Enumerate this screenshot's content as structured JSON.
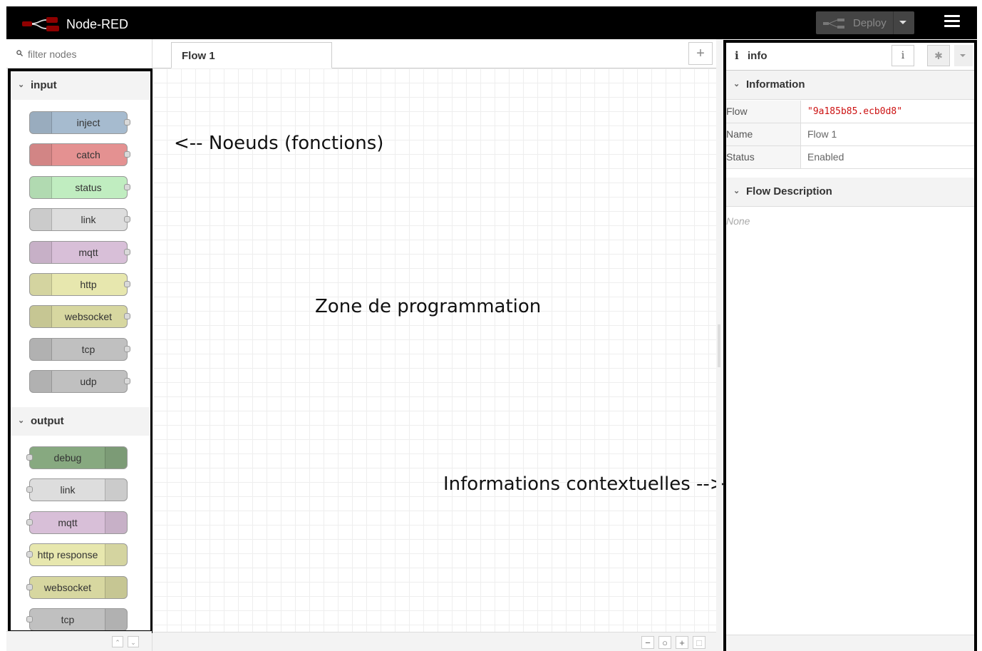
{
  "header": {
    "title": "Node-RED",
    "deploy_label": "Deploy"
  },
  "palette": {
    "filter_placeholder": "filter nodes",
    "categories": [
      {
        "label": "input",
        "nodes": [
          {
            "label": "inject",
            "color": "#a6bbcf"
          },
          {
            "label": "catch",
            "color": "#e49191"
          },
          {
            "label": "status",
            "color": "#c0edc0"
          },
          {
            "label": "link",
            "color": "#dddddd"
          },
          {
            "label": "mqtt",
            "color": "#d8bfd8"
          },
          {
            "label": "http",
            "color": "#e7e7ae"
          },
          {
            "label": "websocket",
            "color": "#d7d7a0"
          },
          {
            "label": "tcp",
            "color": "#c0c0c0"
          },
          {
            "label": "udp",
            "color": "#c0c0c0"
          }
        ]
      },
      {
        "label": "output",
        "nodes": [
          {
            "label": "debug",
            "color": "#87a980"
          },
          {
            "label": "link",
            "color": "#dddddd"
          },
          {
            "label": "mqtt",
            "color": "#d8bfd8"
          },
          {
            "label": "http response",
            "color": "#e7e7ae"
          },
          {
            "label": "websocket",
            "color": "#d7d7a0"
          },
          {
            "label": "tcp",
            "color": "#c0c0c0"
          }
        ]
      }
    ]
  },
  "workspace": {
    "tab_label": "Flow 1",
    "annotations": {
      "nodes": "<-- Noeuds (fonctions)",
      "zone": "Zone de programmation",
      "info": "Informations contextuelles -->"
    }
  },
  "sidebar": {
    "tab_label": "info",
    "info_section": "Information",
    "properties": [
      {
        "key": "Flow",
        "value": "\"9a185b85.ecb0d8\""
      },
      {
        "key": "Name",
        "value": "Flow 1"
      },
      {
        "key": "Status",
        "value": "Enabled"
      }
    ],
    "desc_section": "Flow Description",
    "description": "None"
  }
}
